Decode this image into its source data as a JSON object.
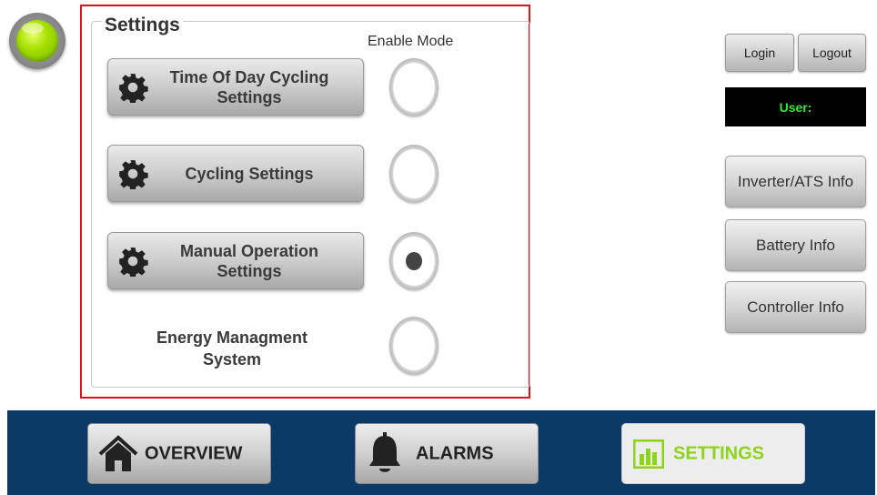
{
  "status": {
    "color": "#8cd41a"
  },
  "settings": {
    "title": "Settings",
    "enable_mode_label": "Enable Mode",
    "items": [
      {
        "label_line1": "Time Of Day Cycling",
        "label_line2": "Settings",
        "enabled": false
      },
      {
        "label_line1": "Cycling Settings",
        "label_line2": "",
        "enabled": false
      },
      {
        "label_line1": "Manual Operation",
        "label_line2": "Settings",
        "enabled": true
      }
    ],
    "ems": {
      "label_line1": "Energy Managment",
      "label_line2": "System",
      "enabled": false
    }
  },
  "auth": {
    "login_label": "Login",
    "logout_label": "Logout",
    "user_label": "User:"
  },
  "info_buttons": [
    "Inverter/ATS Info",
    "Battery Info",
    "Controller Info"
  ],
  "nav": {
    "overview_label": "OVERVIEW",
    "alarms_label": "ALARMS",
    "settings_label": "SETTINGS",
    "active": "settings",
    "active_color": "#8cd41a",
    "bar_color": "#0b3a66"
  },
  "icons": {
    "gear": "gear-icon",
    "home": "home-icon",
    "bell": "bell-icon",
    "chart": "bar-chart-icon"
  }
}
